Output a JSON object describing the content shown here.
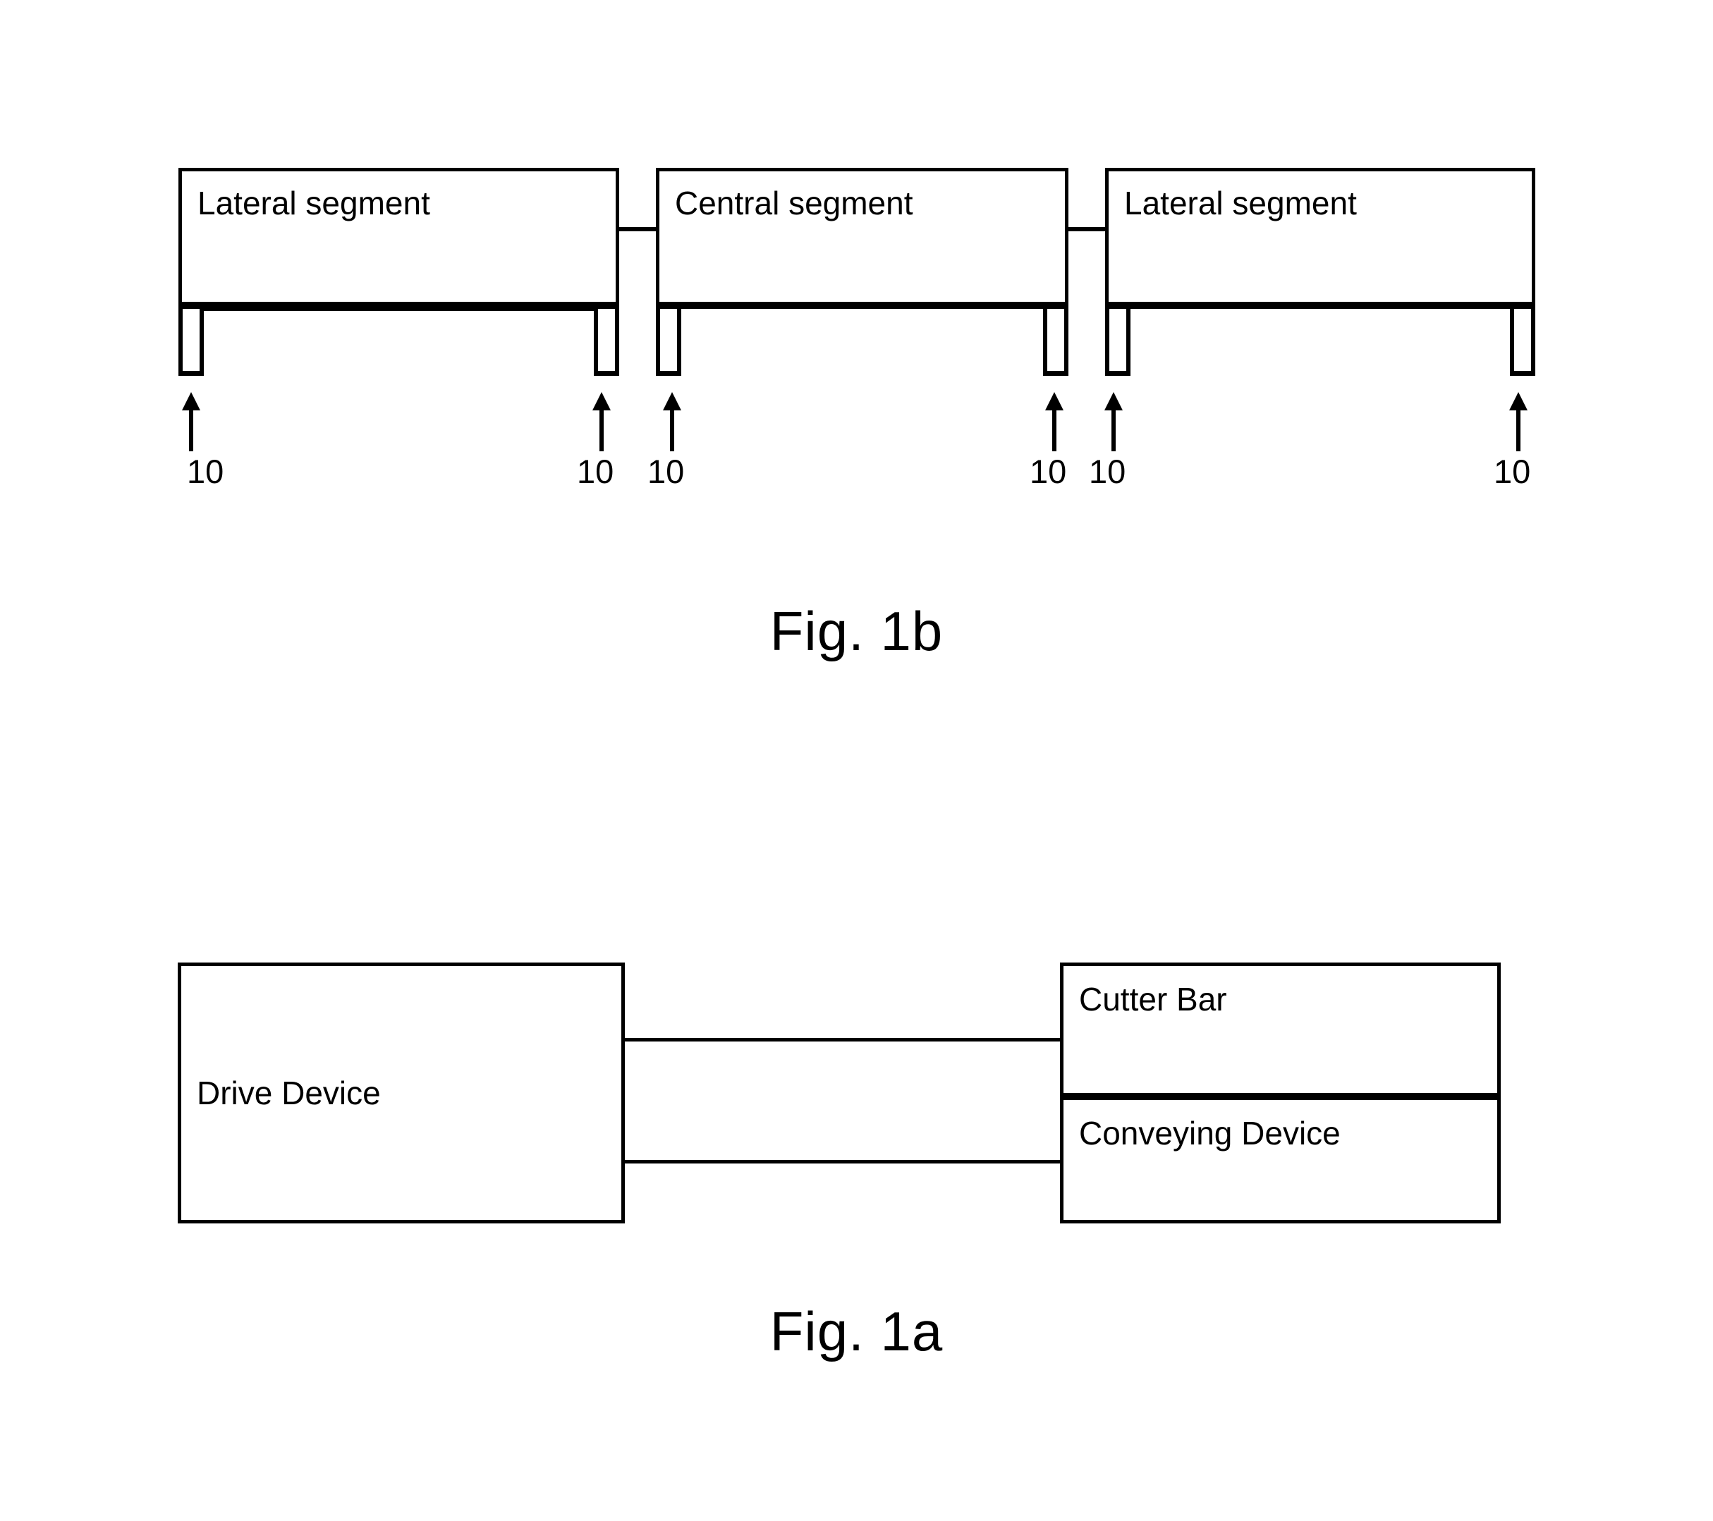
{
  "figures": [
    {
      "id": "fig-1b",
      "caption": "Fig. 1b",
      "segments": [
        {
          "label": "Lateral segment"
        },
        {
          "label": "Central segment"
        },
        {
          "label": "Lateral segment"
        }
      ],
      "reference_marks": [
        {
          "number": "10"
        },
        {
          "number": "10"
        },
        {
          "number": "10"
        },
        {
          "number": "10"
        },
        {
          "number": "10"
        },
        {
          "number": "10"
        }
      ]
    },
    {
      "id": "fig-1a",
      "caption": "Fig. 1a",
      "blocks": [
        {
          "label": "Drive Device"
        },
        {
          "label": "Cutter Bar"
        },
        {
          "label": "Conveying Device"
        }
      ]
    }
  ],
  "colors": {
    "line": "#000000",
    "background": "#ffffff"
  }
}
